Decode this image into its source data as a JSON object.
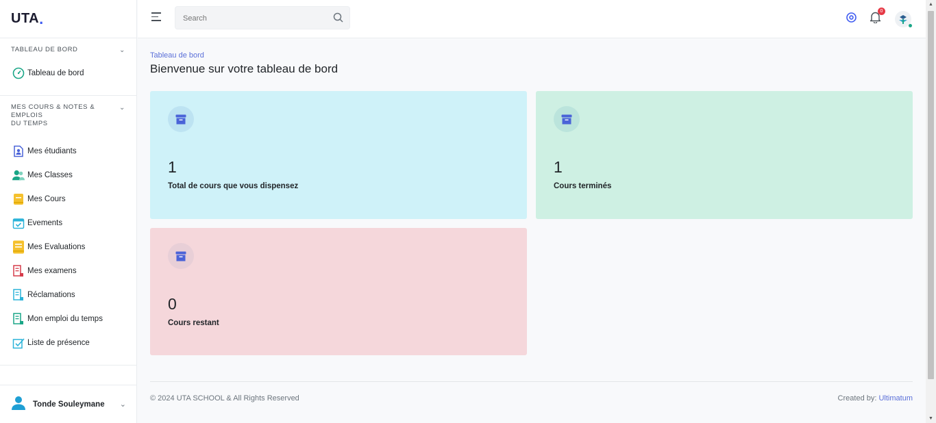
{
  "app": {
    "logo": "UTA",
    "logo_dot": "."
  },
  "sidebar": {
    "sections": [
      {
        "title": "TABLEAU DE BORD",
        "items": [
          {
            "label": "Tableau de bord",
            "icon": "dashboard-gauge-icon"
          }
        ]
      },
      {
        "title_line1": "MES COURS & NOTES & EMPLOIS",
        "title_line2": "DU TEMPS",
        "items": [
          {
            "label": "Mes étudiants",
            "icon": "student-id-icon"
          },
          {
            "label": "Mes Classes",
            "icon": "users-icon"
          },
          {
            "label": "Mes Cours",
            "icon": "book-icon"
          },
          {
            "label": "Evements",
            "icon": "calendar-check-icon"
          },
          {
            "label": "Mes Evaluations",
            "icon": "notebook-icon"
          },
          {
            "label": "Mes examens",
            "icon": "exam-doc-icon"
          },
          {
            "label": "Réclamations",
            "icon": "claims-doc-icon"
          },
          {
            "label": "Mon emploi du temps",
            "icon": "schedule-doc-icon"
          },
          {
            "label": "Liste de présence",
            "icon": "attendance-check-icon"
          }
        ]
      }
    ],
    "user": {
      "name": "Tonde Souleymane"
    }
  },
  "topbar": {
    "search_placeholder": "Search",
    "notifications_count": "0"
  },
  "main": {
    "breadcrumb": "Tableau de bord",
    "title": "Bienvenue sur votre tableau de bord",
    "cards": [
      {
        "value": "1",
        "label": "Total de cours que vous dispensez",
        "bg": "#cff2f9",
        "icon_bg": "#bde3f2"
      },
      {
        "value": "1",
        "label": "Cours terminés",
        "bg": "#cef0e3",
        "icon_bg": "#bbe4dc"
      },
      {
        "value": "0",
        "label": "Cours restant",
        "bg": "#f5d7db",
        "icon_bg": "#e8cfd7"
      }
    ]
  },
  "footer": {
    "copyright": "© 2024 UTA SCHOOL & All Rights Reserved",
    "created_by": "Created by:",
    "author": "Ultimatum"
  },
  "colors": {
    "accent": "#3d5af1",
    "link": "#5a6fd8",
    "icon_blue": "#4a63d8",
    "badge": "#e63946"
  }
}
